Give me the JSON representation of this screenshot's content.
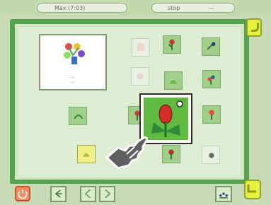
{
  "topbar": {
    "left_label": "Max (7:03)",
    "right_label": "stop",
    "right_value": "—"
  },
  "preview": {
    "line1": "—",
    "line2": "—"
  },
  "icons": {
    "power": "power-icon",
    "back": "back-icon",
    "prev": "previous-page-icon",
    "next": "next-page-icon",
    "right": "flower-grid-icon"
  }
}
